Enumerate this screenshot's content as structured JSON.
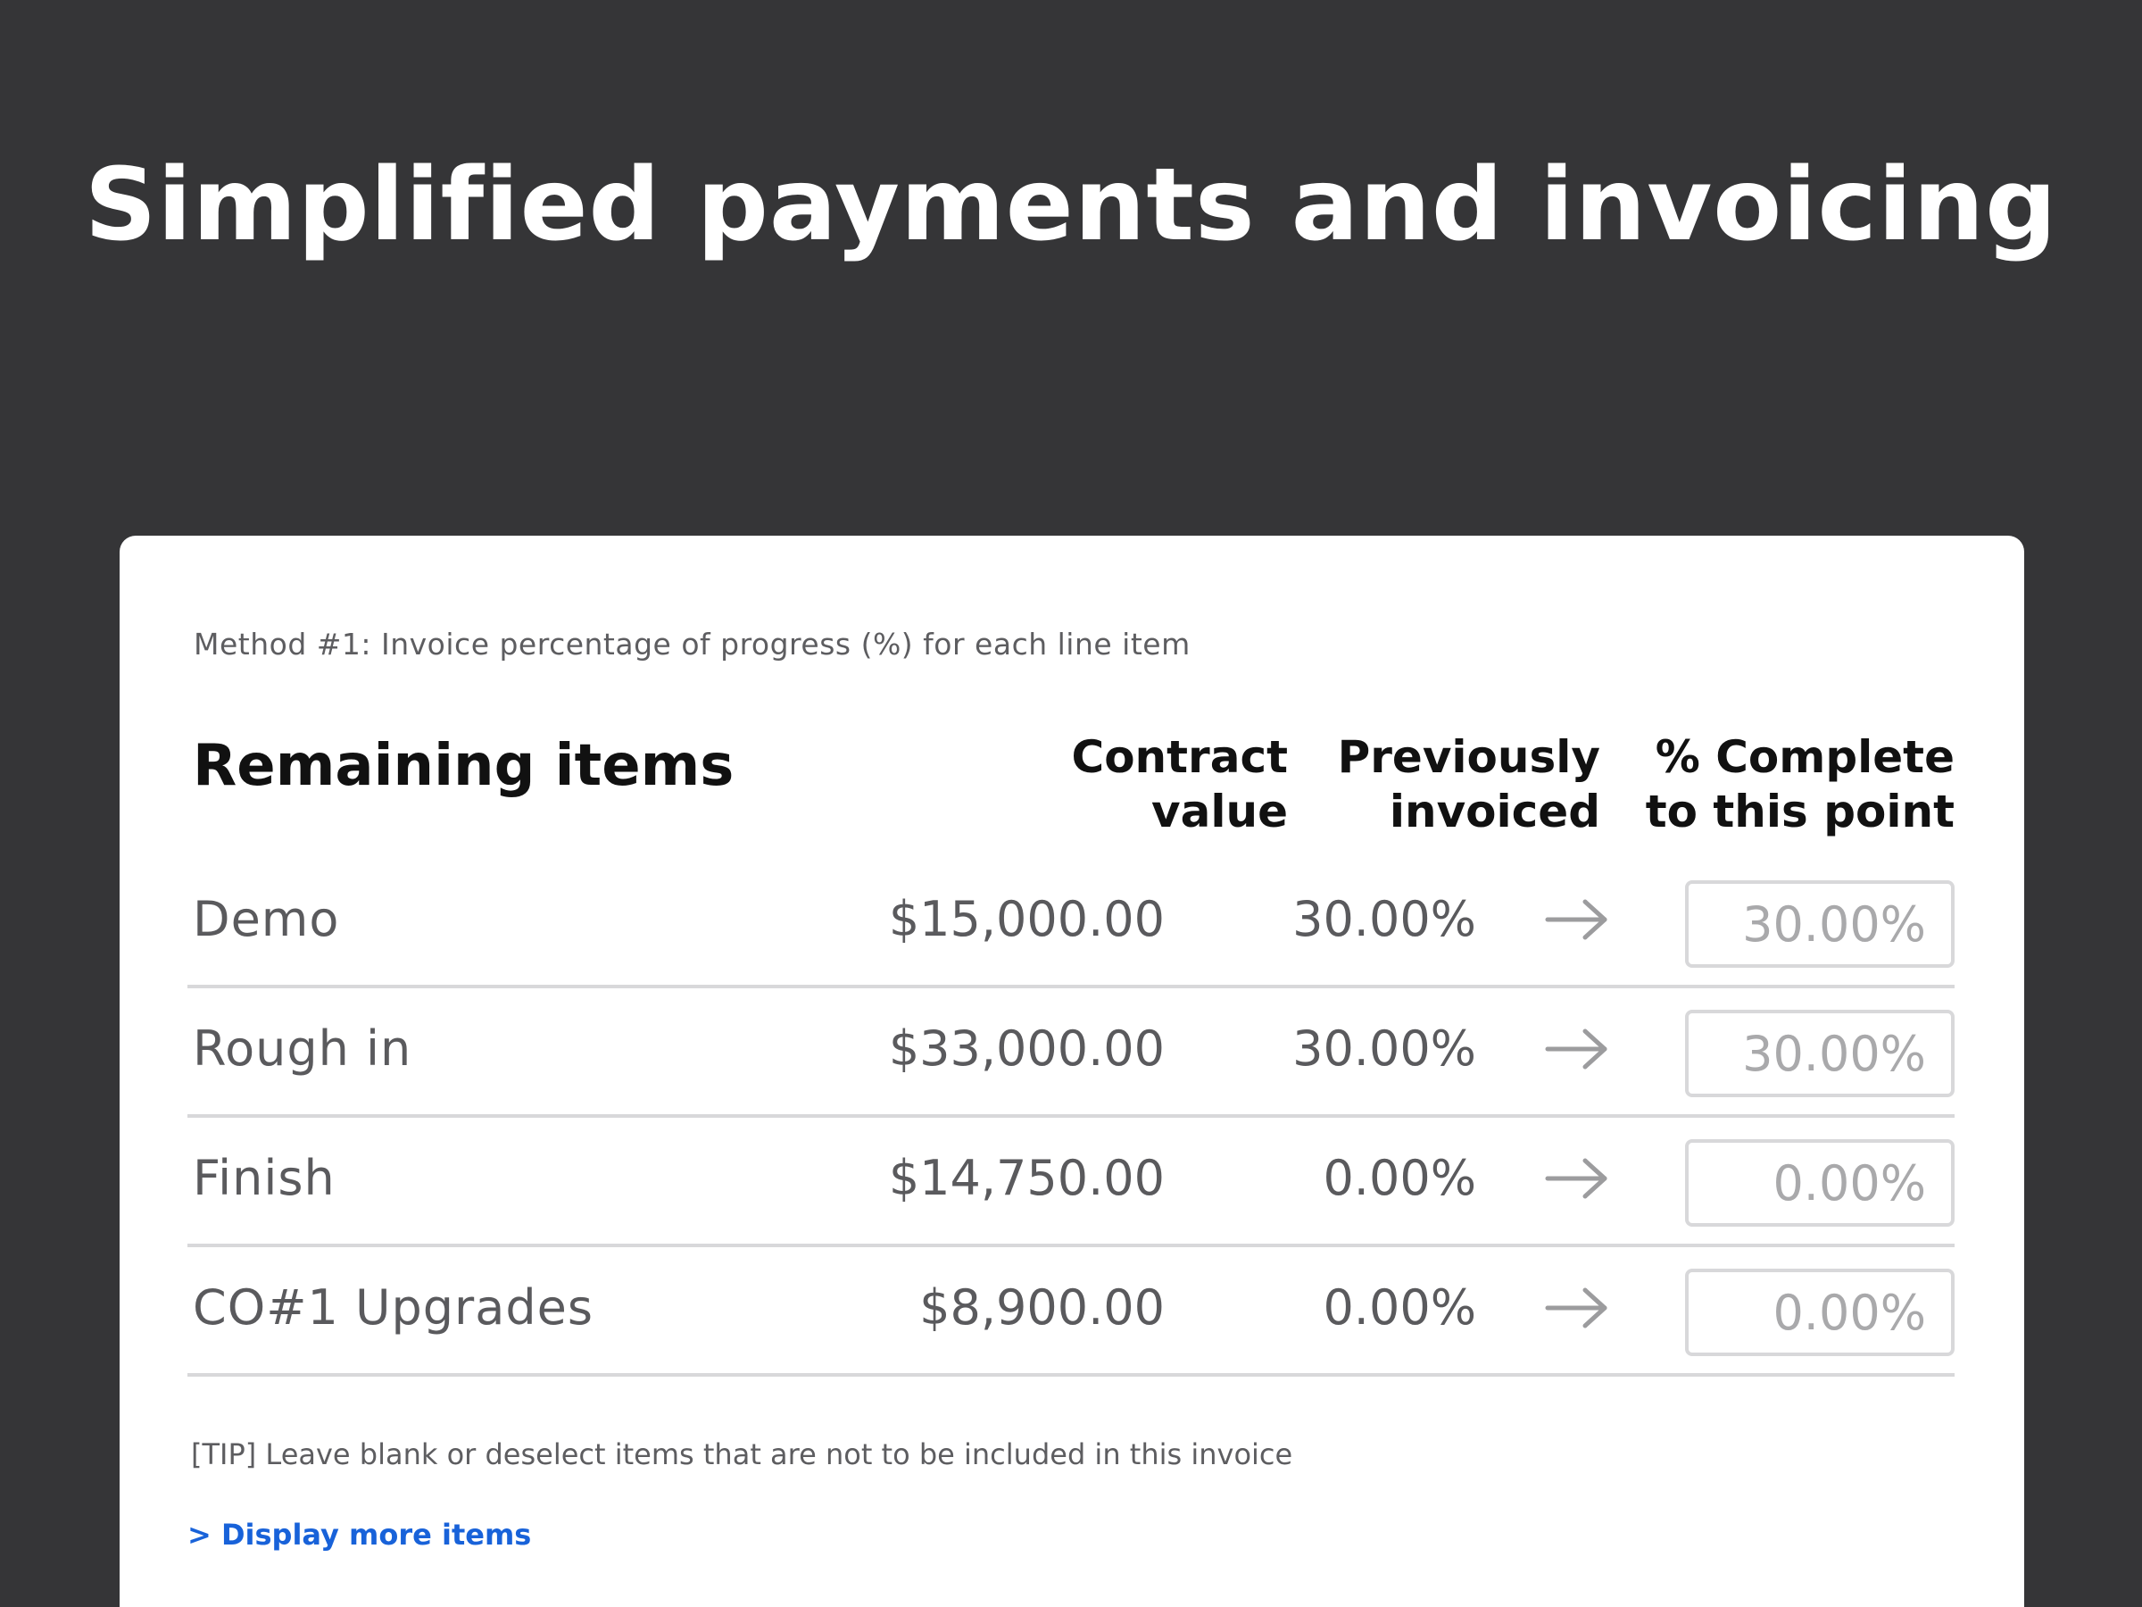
{
  "hero": {
    "title": "Simplified payments and invoicing"
  },
  "card": {
    "method_label": "Method #1: Invoice percentage of progress (%) for each line item",
    "headers": {
      "items": "Remaining items",
      "contract_line1": "Contract",
      "contract_line2": "value",
      "previous_line1": "Previously",
      "previous_line2": "invoiced",
      "complete_line1": "% Complete",
      "complete_line2": "to this point"
    },
    "rows": [
      {
        "name": "Demo",
        "contract_value": "$15,000.00",
        "previously_invoiced": "30.00%",
        "percent_complete": "30.00%"
      },
      {
        "name": "Rough in",
        "contract_value": "$33,000.00",
        "previously_invoiced": "30.00%",
        "percent_complete": "30.00%"
      },
      {
        "name": "Finish",
        "contract_value": "$14,750.00",
        "previously_invoiced": "0.00%",
        "percent_complete": "0.00%"
      },
      {
        "name": "CO#1 Upgrades",
        "contract_value": "$8,900.00",
        "previously_invoiced": "0.00%",
        "percent_complete": "0.00%"
      }
    ],
    "tip": "[TIP] Leave blank or deselect items that are not to be included in this invoice",
    "display_more_label": "> Display more items"
  },
  "icons": {
    "row_arrow": "arrow-right-icon"
  },
  "colors": {
    "background": "#353537",
    "card": "#ffffff",
    "link": "#1862d9",
    "divider": "#d8d8da"
  }
}
